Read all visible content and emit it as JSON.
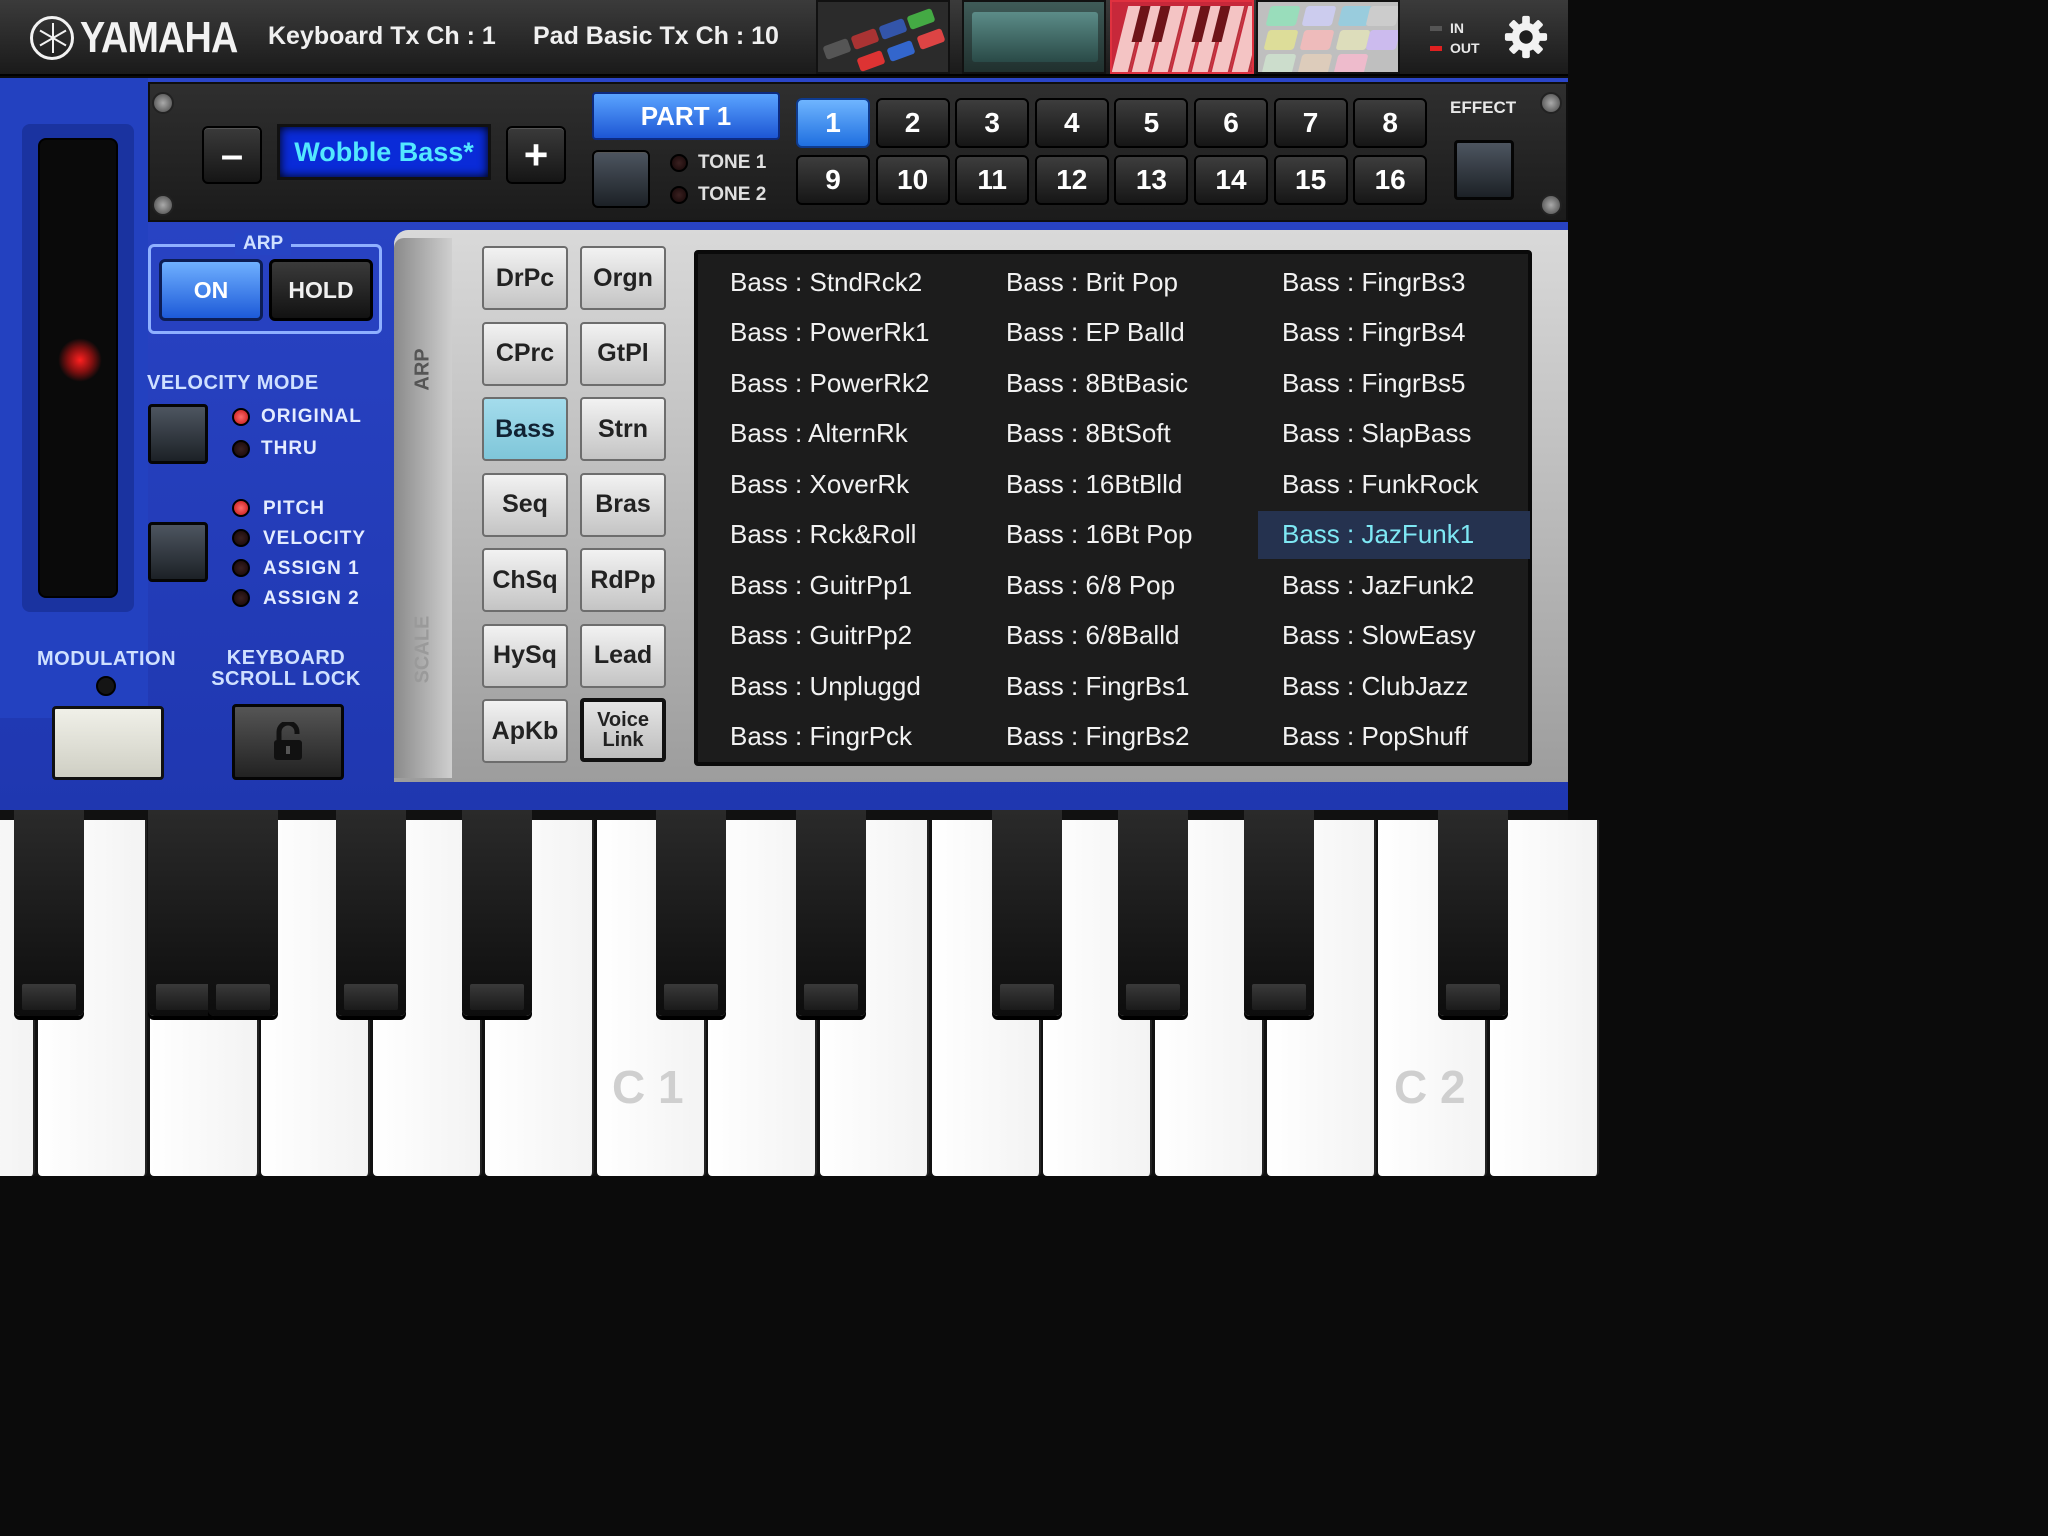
{
  "header": {
    "brand": "YAMAHA",
    "keyboard_tx": "Keyboard Tx Ch : 1",
    "pad_tx": "Pad Basic Tx Ch : 10",
    "midi_in": "IN",
    "midi_out": "OUT"
  },
  "part_strip": {
    "minus": "–",
    "plus": "+",
    "voice_name": "Wobble Bass*",
    "part": "PART 1",
    "tone1": "TONE 1",
    "tone2": "TONE 2",
    "effect": "EFFECT",
    "channels": [
      "1",
      "2",
      "3",
      "4",
      "5",
      "6",
      "7",
      "8",
      "9",
      "10",
      "11",
      "12",
      "13",
      "14",
      "15",
      "16"
    ],
    "active_channel": "1"
  },
  "arp": {
    "title": "ARP",
    "on": "ON",
    "hold": "HOLD"
  },
  "velocity": {
    "title": "VELOCITY MODE",
    "original": "ORIGINAL",
    "thru": "THRU"
  },
  "assign": {
    "pitch": "PITCH",
    "velocity": "VELOCITY",
    "assign1": "ASSIGN 1",
    "assign2": "ASSIGN 2"
  },
  "bottom": {
    "modulation": "MODULATION",
    "scroll_lock_1": "KEYBOARD",
    "scroll_lock_2": "SCROLL LOCK"
  },
  "side_tabs": {
    "arp": "ARP",
    "scale": "SCALE"
  },
  "categories": [
    "DrPc",
    "Orgn",
    "CPrc",
    "GtPl",
    "Bass",
    "Strn",
    "Seq",
    "Bras",
    "ChSq",
    "RdPp",
    "HySq",
    "Lead",
    "ApKb"
  ],
  "active_category": "Bass",
  "voice_link": {
    "line1": "Voice",
    "line2": "Link"
  },
  "voices": [
    [
      "Bass : StndRck2",
      "Bass : PowerRk1",
      "Bass : PowerRk2",
      "Bass : AlternRk",
      "Bass : XoverRk",
      "Bass : Rck&Roll",
      "Bass : GuitrPp1",
      "Bass : GuitrPp2",
      "Bass : Unpluggd",
      "Bass : FingrPck"
    ],
    [
      "Bass : Brit Pop",
      "Bass : EP Balld",
      "Bass : 8BtBasic",
      "Bass : 8BtSoft",
      "Bass : 16BtBlld",
      "Bass : 16Bt Pop",
      "Bass : 6/8 Pop",
      "Bass : 6/8Balld",
      "Bass : FingrBs1",
      "Bass : FingrBs2"
    ],
    [
      "Bass : FingrBs3",
      "Bass : FingrBs4",
      "Bass : FingrBs5",
      "Bass : SlapBass",
      "Bass : FunkRock",
      "Bass : JazFunk1",
      "Bass : JazFunk2",
      "Bass : SlowEasy",
      "Bass : ClubJazz",
      "Bass : PopShuff"
    ]
  ],
  "selected_voice": "Bass : JazFunk1",
  "keyboard": {
    "c1": "C 1",
    "c2": "C 2"
  },
  "colors": {
    "body_blue": "#2341c0",
    "accent_cyan": "#53e8ff",
    "active_blue": "#1f6fe0",
    "selected_text": "#7ee8f4"
  }
}
